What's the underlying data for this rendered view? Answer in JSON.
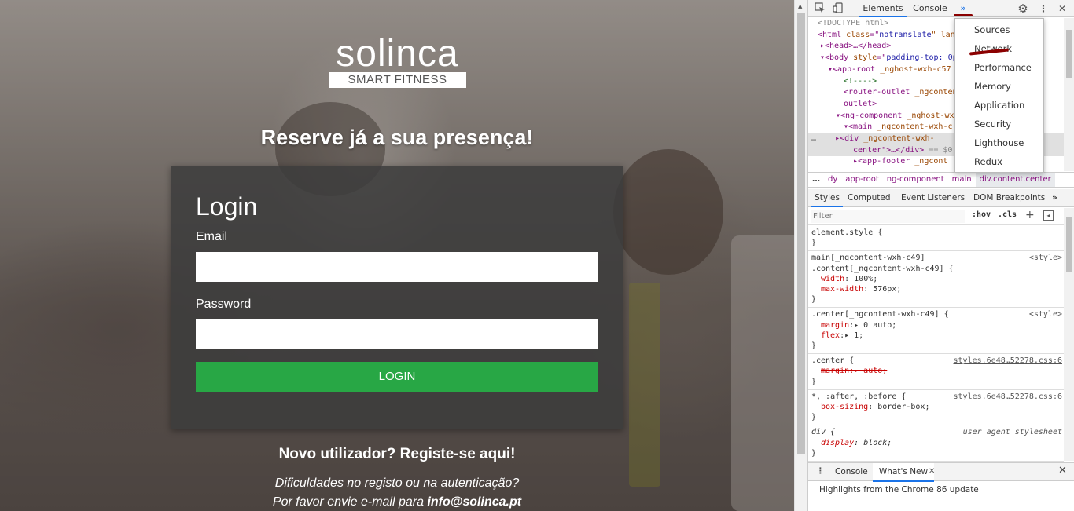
{
  "site": {
    "logo_word": "solinca",
    "logo_sub": "SMART FITNESS",
    "tagline": "Reserve já a sua presença!",
    "login_title": "Login",
    "email_label": "Email",
    "email_value": "",
    "password_label": "Password",
    "password_value": "",
    "login_button": "LOGIN",
    "register_text": "Novo utilizador? Registe-se aqui!",
    "help_line1": "Dificuldades no registo ou na autenticação?",
    "help_line2_prefix": "Por favor envie e-mail para ",
    "help_email": "info@solinca.pt",
    "colors": {
      "login_button": "#28a745",
      "panel": "#3c3c3c"
    }
  },
  "devtools": {
    "toolbar": {
      "inspect_icon": "inspect-element-icon",
      "device_icon": "device-toolbar-icon",
      "tabs": [
        "Elements",
        "Console"
      ],
      "more_tabs": "»",
      "settings_icon": "gear-icon",
      "menu_icon": "kebab-menu-icon",
      "close": "✕"
    },
    "more_menu": [
      "Sources",
      "Network",
      "Performance",
      "Memory",
      "Application",
      "Security",
      "Lighthouse",
      "Redux"
    ],
    "dom": {
      "l1": "<!DOCTYPE html>",
      "l2a": "<html ",
      "l2b": "class",
      "l2c": "=\"",
      "l2d": "notranslate",
      "l2e": "\" lang",
      "l3": "▸<head>…</head>",
      "l4a": "▾<body ",
      "l4b": "style",
      "l4c": "=\"",
      "l4d": "padding-top: 0p",
      "l5a": "▾<app-root ",
      "l5b": "_nghost-wxh-c57",
      "l6": "<!---->",
      "l7a": "<router-outlet ",
      "l7b": "_ngconten",
      "l8": "outlet>",
      "l9a": "▾<ng-component ",
      "l9b": "_nghost-wx",
      "l10a": "▾<main ",
      "l10b": "_ngcontent-wxh-c",
      "l11a": "▸<div ",
      "l11b": "_ngcontent-wxh-",
      "l12a": "center\">…</div>",
      "l12b": " == $0",
      "l13a": "▸<app-footer ",
      "l13b": "_ngcont"
    },
    "breadcrumbs": [
      "…",
      "dy",
      "app-root",
      "ng-component",
      "main",
      "div.content.center"
    ],
    "styles_tabs": [
      "Styles",
      "Computed",
      "Event Listeners",
      "DOM Breakpoints",
      "»"
    ],
    "filter_placeholder": "Filter",
    "hov": ":hov",
    "cls": ".cls",
    "rules": {
      "r1_sel": "element.style {",
      "r1_end": "}",
      "r2_sel1": "main[_ngcontent-wxh-c49]",
      "r2_sel2": ".content[_ngcontent-wxh-c49] {",
      "r2_src": "<style>",
      "r2_p1": "width",
      "r2_v1": ": 100%;",
      "r2_p2": "max-width",
      "r2_v2": ": 576px;",
      "r2_end": "}",
      "r3_sel": ".center[_ngcontent-wxh-c49] {",
      "r3_src": "<style>",
      "r3_p1": "margin",
      "r3_v1": ":▸ 0 auto;",
      "r3_p2": "flex",
      "r3_v2": ":▸ 1;",
      "r3_end": "}",
      "r4_sel": ".center {",
      "r4_src": "styles.6e48…52278.css:6",
      "r4_p1": "margin:▸ auto;",
      "r4_end": "}",
      "r5_sel": "*, :after, :before {",
      "r5_src": "styles.6e48…52278.css:6",
      "r5_p1": "box-sizing",
      "r5_v1": ": border-box;",
      "r5_end": "}",
      "r6_sel": "div {",
      "r6_src": "user agent stylesheet",
      "r6_p1": "display",
      "r6_v1": ": block;",
      "r6_end": "}"
    },
    "drawer": {
      "dots": "⋮",
      "console": "Console",
      "whats_new": "What's New",
      "whats_new_close": "✕",
      "close": "✕",
      "highlights": "Highlights from the Chrome 86 update"
    },
    "colors": {
      "active_tab": "#1a73e8",
      "annotation": "#8b0000"
    }
  }
}
